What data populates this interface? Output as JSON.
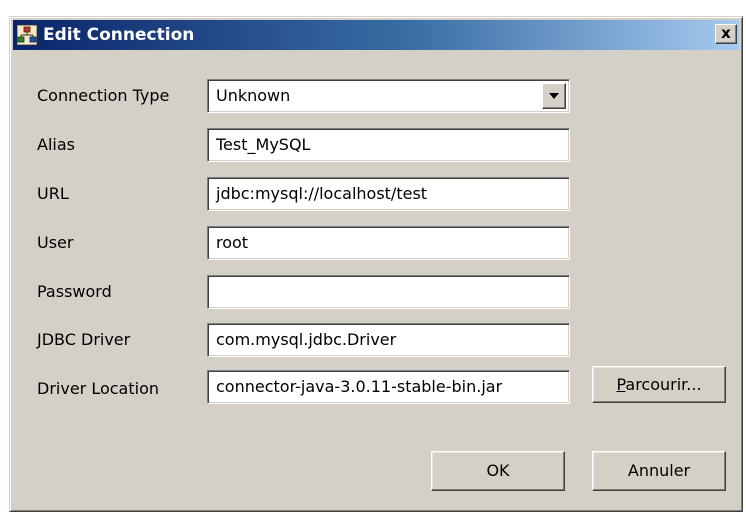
{
  "window": {
    "title": "Edit Connection",
    "close_glyph": "x",
    "icon": "database-tree-icon"
  },
  "form": {
    "connection_type": {
      "label": "Connection Type",
      "value": "Unknown"
    },
    "alias": {
      "label": "Alias",
      "value": "Test_MySQL"
    },
    "url": {
      "label": "URL",
      "value": "jdbc:mysql://localhost/test"
    },
    "user": {
      "label": "User",
      "value": "root"
    },
    "password": {
      "label": "Password",
      "value": ""
    },
    "jdbc_driver": {
      "label": "JDBC Driver",
      "value": "com.mysql.jdbc.Driver"
    },
    "driver_location": {
      "label": "Driver Location",
      "value": "connector-java-3.0.11-stable-bin.jar"
    }
  },
  "buttons": {
    "browse_mnemonic": "P",
    "browse_rest": "arcourir...",
    "ok": "OK",
    "cancel": "Annuler"
  },
  "colors": {
    "title_gradient_start": "#0a246a",
    "title_gradient_end": "#a6caf0",
    "dialog_bg": "#d4d0c8"
  }
}
